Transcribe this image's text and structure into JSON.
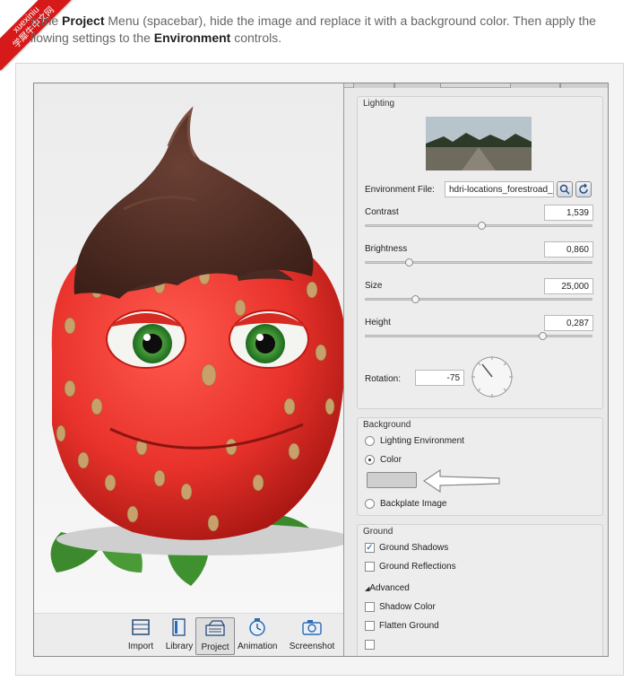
{
  "intro": {
    "part1": "n the ",
    "bold1": "Project",
    "part2": " Menu (spacebar), hide the image and replace it with a background color. Then apply the",
    "part3": "llowing settings to the ",
    "bold2": "Environment",
    "part4": " controls."
  },
  "watermark": {
    "line1": "xuexiniu",
    "line2": "学犀牛中文网"
  },
  "toolbar": {
    "items": [
      {
        "label": "Import"
      },
      {
        "label": "Library"
      },
      {
        "label": "Project"
      },
      {
        "label": "Animation"
      },
      {
        "label": "Screenshot"
      }
    ],
    "active": "Project"
  },
  "panel": {
    "tabs": [
      "",
      "",
      "",
      "",
      ""
    ],
    "lighting": {
      "title": "Lighting",
      "env_file_label": "Environment File:",
      "env_file_value": "hdri-locations_forestroad_",
      "contrast": {
        "label": "Contrast",
        "value": "1,539",
        "level": 0.51
      },
      "brightness": {
        "label": "Brightness",
        "value": "0,860",
        "level": 0.19
      },
      "size": {
        "label": "Size",
        "value": "25,000",
        "level": 0.22
      },
      "height": {
        "label": "Height",
        "value": "0,287",
        "level": 0.78
      },
      "rotation": {
        "label": "Rotation:",
        "value": "-75"
      }
    },
    "background": {
      "title": "Background",
      "opt1": "Lighting Environment",
      "opt2": "Color",
      "opt3": "Backplate Image",
      "selected": "Color",
      "swatch_color": "#cfcfcf"
    },
    "ground": {
      "title": "Ground",
      "shadows": "Ground Shadows",
      "reflections": "Ground Reflections",
      "advanced": "Advanced",
      "shadow_color": "Shadow Color",
      "flatten": "Flatten Ground"
    }
  },
  "colors": {
    "strawberry": "#e8322b",
    "chocolate": "#4a2a22",
    "watermark": "#d61a1a"
  }
}
